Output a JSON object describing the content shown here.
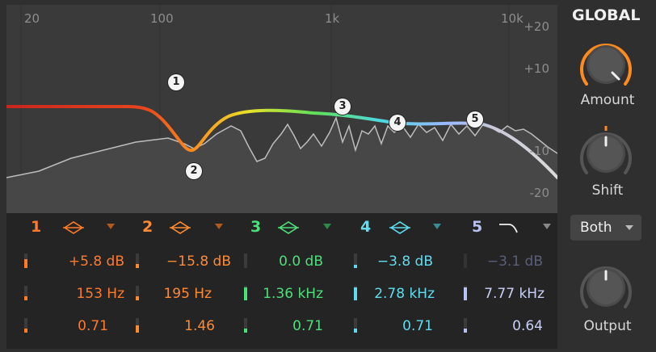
{
  "graph": {
    "freq_labels": [
      "20",
      "100",
      "1k",
      "10k"
    ],
    "db_labels": [
      "+20",
      "+10",
      "-10",
      "-20"
    ],
    "nodes": [
      "1",
      "2",
      "3",
      "4",
      "5"
    ]
  },
  "bands": [
    {
      "num": "1",
      "color": "#ff7a2a",
      "shape": "bell",
      "gain": "+5.8 dB",
      "freq": "153 Hz",
      "q": "0.71",
      "gain_level": 0.6,
      "freq_level": 0.3,
      "q_level": 0.3
    },
    {
      "num": "2",
      "color": "#ff8a32",
      "shape": "bell",
      "gain": "−15.8 dB",
      "freq": "195 Hz",
      "q": "1.46",
      "gain_level": 0.3,
      "freq_level": 0.3,
      "q_level": 0.5
    },
    {
      "num": "3",
      "color": "#4ce07a",
      "shape": "bell",
      "gain": "0.0 dB",
      "freq": "1.36 kHz",
      "q": "0.71",
      "gain_level": 0.0,
      "freq_level": 0.9,
      "q_level": 0.3
    },
    {
      "num": "4",
      "color": "#5fdcf0",
      "shape": "bell",
      "gain": "−3.8 dB",
      "freq": "2.78 kHz",
      "q": "0.71",
      "gain_level": 0.2,
      "freq_level": 0.9,
      "q_level": 0.3
    },
    {
      "num": "5",
      "color": "#b8c2f2",
      "shape": "low-pass",
      "gain": "−3.1 dB",
      "freq": "7.77 kHz",
      "q": "0.64",
      "gain_level": 0.0,
      "freq_level": 0.9,
      "q_level": 0.3,
      "gain_dimmed": true
    }
  ],
  "global": {
    "title": "GLOBAL",
    "amount_label": "Amount",
    "shift_label": "Shift",
    "mode_value": "Both",
    "output_label": "Output"
  },
  "colors": {
    "amount_ring": "#ff8a1e",
    "shift_ring": "#ff8a1e"
  }
}
